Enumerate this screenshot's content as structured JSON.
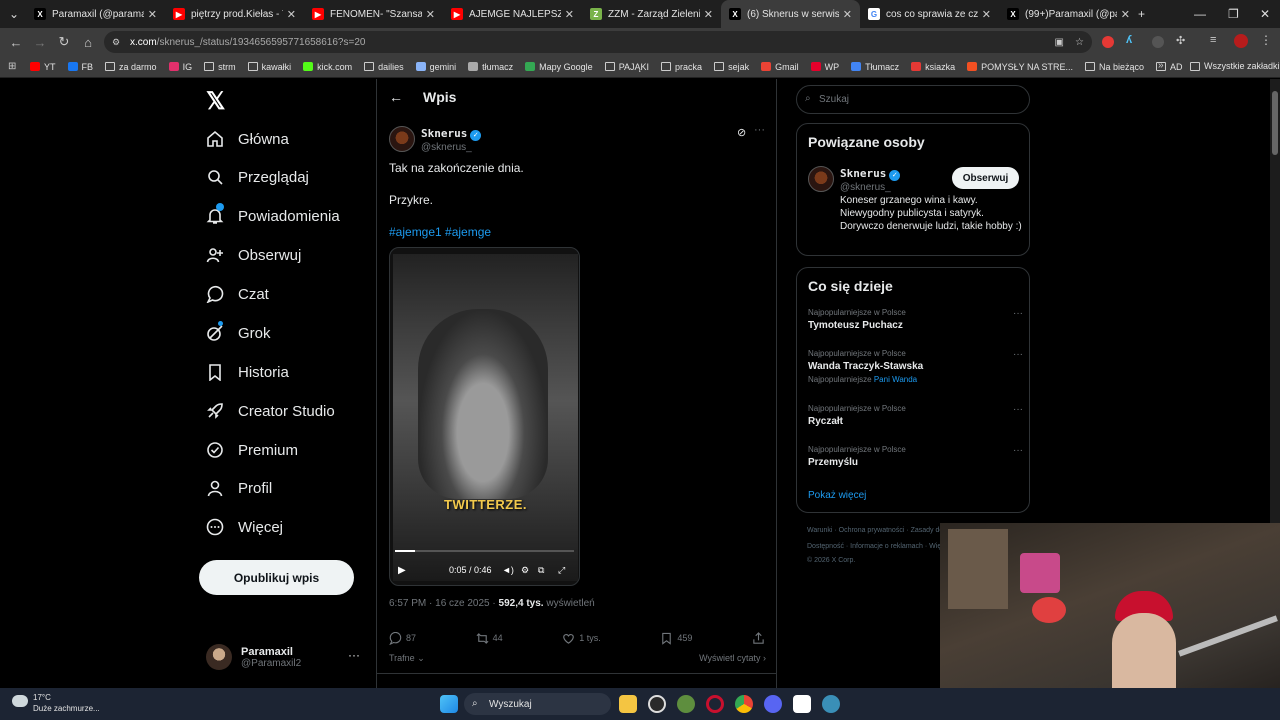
{
  "browser": {
    "tabs": [
      {
        "title": "Paramaxil (@paramaxil_) |",
        "color": "#000000",
        "glyph": "X"
      },
      {
        "title": "piętrzy prod.Kiełas - YouTube",
        "color": "#ff0000",
        "glyph": "▶"
      },
      {
        "title": "FENOMEN- \"Szansa\" - YouTube",
        "color": "#ff0000",
        "glyph": "▶"
      },
      {
        "title": "AJEMGE NAJLEPSZE MOM",
        "color": "#ff0000",
        "glyph": "▶"
      },
      {
        "title": "ZZM - Zarząd Zieleni Miej",
        "color": "#7ab34a",
        "glyph": "Z"
      },
      {
        "title": "(6) Sknerus w serwisie X",
        "color": "#000000",
        "glyph": "X",
        "active": true
      },
      {
        "title": "cos co sprawia ze czujesz",
        "color": "#ffffff",
        "glyph": "G"
      },
      {
        "title": "(99+)Paramaxil (@param",
        "color": "#000000",
        "glyph": "X"
      }
    ],
    "url_host": "x.com",
    "url_path": "/sknerus_/status/1934656595771658616?s=20",
    "bookmarks": [
      {
        "label": "YT",
        "icon": "youtube-icon",
        "color": "#ff0000"
      },
      {
        "label": "FB",
        "icon": "facebook-icon",
        "color": "#1877f2"
      },
      {
        "label": "za darmo",
        "icon": "folder-icon"
      },
      {
        "label": "IG",
        "icon": "instagram-icon",
        "color": "#e1306c"
      },
      {
        "label": "strm",
        "icon": "folder-icon"
      },
      {
        "label": "kawałki",
        "icon": "folder-icon"
      },
      {
        "label": "kick.com",
        "icon": "kick-icon",
        "color": "#53fc18"
      },
      {
        "label": "dailies",
        "icon": "folder-icon"
      },
      {
        "label": "gemini",
        "icon": "gemini-icon",
        "color": "#8ab4f8"
      },
      {
        "label": "tłumacz",
        "icon": "translate-icon",
        "color": "#aaaaaa"
      },
      {
        "label": "Mapy Google",
        "icon": "maps-icon",
        "color": "#34a853"
      },
      {
        "label": "PAJĄKI",
        "icon": "folder-icon"
      },
      {
        "label": "pracka",
        "icon": "folder-icon"
      },
      {
        "label": "sejak",
        "icon": "folder-icon"
      },
      {
        "label": "Gmail",
        "icon": "gmail-icon",
        "color": "#ea4335"
      },
      {
        "label": "WP",
        "icon": "wp-icon",
        "color": "#e4002b"
      },
      {
        "label": "Tłumacz",
        "icon": "translate-icon",
        "color": "#4285f4"
      },
      {
        "label": "ksiazka",
        "icon": "book-icon",
        "color": "#e53935"
      },
      {
        "label": "POMYSŁY NA STRE...",
        "icon": "windows-icon",
        "color": "#f25022"
      },
      {
        "label": "Na bieżąco",
        "icon": "folder-icon"
      },
      {
        "label": "AD",
        "icon": "folder-icon"
      }
    ],
    "all_bookmarks": "Wszystkie zakładki"
  },
  "nav": {
    "items": [
      {
        "label": "Główna",
        "icon": "home-icon"
      },
      {
        "label": "Przeglądaj",
        "icon": "search-icon"
      },
      {
        "label": "Powiadomienia",
        "icon": "bell-icon",
        "badge": "6"
      },
      {
        "label": "Obserwuj",
        "icon": "person-add-icon"
      },
      {
        "label": "Czat",
        "icon": "chat-icon"
      },
      {
        "label": "Grok",
        "icon": "grok-icon"
      },
      {
        "label": "Historia",
        "icon": "bookmark-icon"
      },
      {
        "label": "Creator Studio",
        "icon": "rocket-icon"
      },
      {
        "label": "Premium",
        "icon": "verified-icon"
      },
      {
        "label": "Profil",
        "icon": "person-icon"
      },
      {
        "label": "Więcej",
        "icon": "more-circle-icon"
      }
    ],
    "post_button": "Opublikuj wpis",
    "account": {
      "name": "Paramaxil",
      "handle": "@Paramaxil2"
    }
  },
  "post": {
    "header": "Wpis",
    "author": {
      "name": "Sknerus",
      "handle": "@sknerus_"
    },
    "text_line1": "Tak na zakończenie dnia.",
    "text_line2": "Przykre.",
    "hashtags": "#ajemge1 #ajemge",
    "video": {
      "caption": "TWITTERZE.",
      "time": "0:05 / 0:46",
      "progress": 0.11
    },
    "time": "6:57 PM · 16 cze 2025 · ",
    "views": "592,4 tys.",
    "views_label": " wyświetleń",
    "stats": {
      "replies": "87",
      "reposts": "44",
      "likes": "1 tys.",
      "bookmarks": "459"
    },
    "sort": "Trafne",
    "quotes": "Wyświetl cytaty"
  },
  "sidebar": {
    "search_placeholder": "Szukaj",
    "related_title": "Powiązane osoby",
    "related_person": {
      "name": "Sknerus",
      "handle": "@sknerus_",
      "follow": "Obserwuj",
      "bio": "Koneser grzanego wina i kawy. Niewygodny publicysta i satyryk. Dorywczo denerwuje ludzi, takie hobby :)"
    },
    "trends_title": "Co się dzieje",
    "trends": [
      {
        "context": "Najpopularniejsze w Polsce",
        "title": "Tymoteusz Puchacz"
      },
      {
        "context": "Najpopularniejsze w Polsce",
        "title": "Wanda Traczyk-Stawska",
        "extra_prefix": "Najpopularniejsze ",
        "extra_link": "Pani Wanda"
      },
      {
        "context": "Najpopularniejsze w Polsce",
        "title": "Ryczałt"
      },
      {
        "context": "Najpopularniejsze w Polsce",
        "title": "Przemyślu"
      }
    ],
    "show_more": "Pokaż więcej",
    "footer_line1": "Warunki · Ochrona prywatności · Zasady dotyczące plików cookie",
    "footer_line2": "Dostępność · Informacje o reklamach · Więcej ···",
    "footer_line3": "© 2026 X Corp."
  },
  "taskbar": {
    "weather_temp": "17°C",
    "weather_desc": "Duże zachmurze...",
    "search": "Wyszukaj"
  }
}
